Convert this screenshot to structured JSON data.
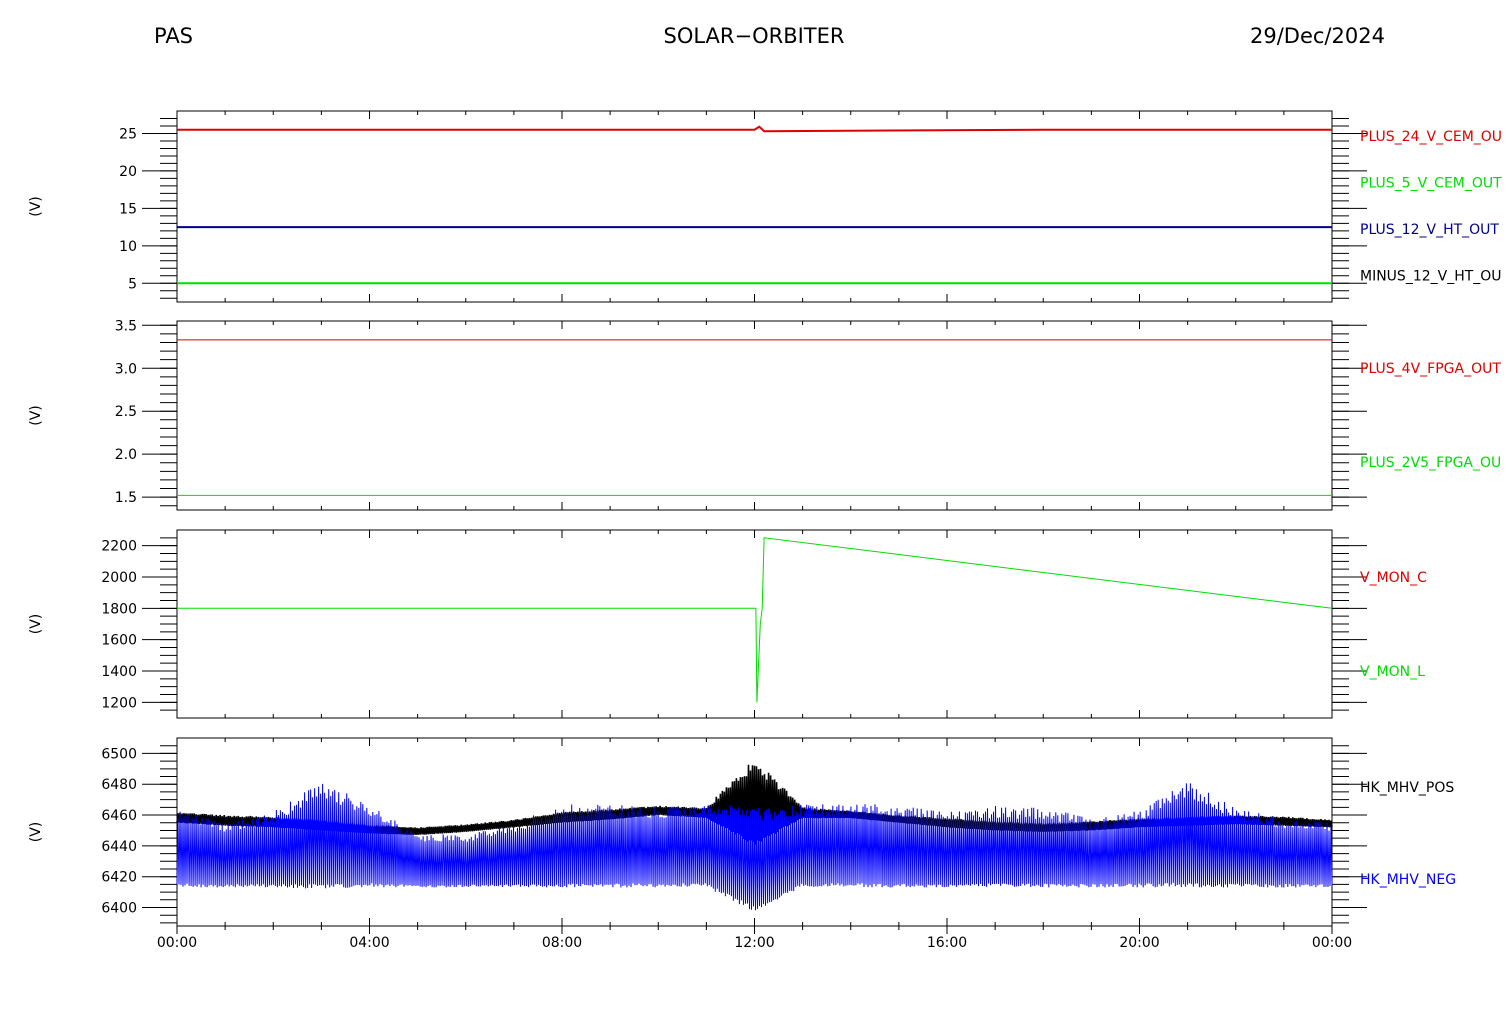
{
  "header": {
    "left": "PAS",
    "center": "SOLAR−ORBITER",
    "right": "29/Dec/2024"
  },
  "colors": {
    "red": "#dd0000",
    "green": "#00dd00",
    "navy": "#000088",
    "blue": "#0000ff",
    "black": "#000000"
  },
  "x_ticks": [
    "00:00",
    "04:00",
    "08:00",
    "12:00",
    "16:00",
    "20:00",
    "00:00"
  ],
  "chart_data": [
    {
      "type": "line",
      "ylabel": "(V)",
      "xlim": [
        0,
        24
      ],
      "ylim": [
        2.5,
        28
      ],
      "yticks": [
        5,
        10,
        15,
        20,
        25
      ],
      "minor": 1,
      "legend": [
        "PLUS_24_V_CEM_OU",
        "PLUS_5_V_CEM_OUT",
        "PLUS_12_V_HT_OUT",
        "MINUS_12_V_HT_OU"
      ],
      "legend_colors": [
        "red",
        "green",
        "navy",
        "black"
      ],
      "series": [
        {
          "name": "PLUS_24_V_CEM_OU",
          "color": "red",
          "x": [
            0,
            6,
            12,
            12.1,
            12.2,
            18,
            24
          ],
          "y": [
            25.5,
            25.5,
            25.5,
            25.9,
            25.3,
            25.5,
            25.5
          ]
        },
        {
          "name": "PLUS_5_V_CEM_OUT",
          "color": "green",
          "x": [
            0,
            24
          ],
          "y": [
            5.0,
            5.0
          ]
        },
        {
          "name": "PLUS_12_V_HT_OUT",
          "color": "navy",
          "x": [
            0,
            24
          ],
          "y": [
            12.5,
            12.5
          ]
        }
      ]
    },
    {
      "type": "line",
      "ylabel": "(V)",
      "xlim": [
        0,
        24
      ],
      "ylim": [
        1.35,
        3.55
      ],
      "yticks": [
        1.5,
        2.0,
        2.5,
        3.0,
        3.5
      ],
      "minor": 0.1,
      "legend": [
        "PLUS_4V_FPGA_OUT",
        "PLUS_2V5_FPGA_OU"
      ],
      "legend_colors": [
        "red",
        "green"
      ],
      "series": [
        {
          "name": "PLUS_4V_FPGA_OUT",
          "color": "red",
          "x": [
            0,
            24
          ],
          "y": [
            3.33,
            3.33
          ]
        },
        {
          "name": "PLUS_2V5_FPGA_OU",
          "color": "green",
          "x": [
            0,
            24
          ],
          "y": [
            1.52,
            1.52
          ]
        }
      ]
    },
    {
      "type": "line",
      "ylabel": "(V)",
      "xlim": [
        0,
        24
      ],
      "ylim": [
        1100,
        2300
      ],
      "yticks": [
        1200,
        1400,
        1600,
        1800,
        2000,
        2200
      ],
      "minor": 50,
      "legend": [
        "V_MON_C",
        "V_MON_L"
      ],
      "legend_colors": [
        "red",
        "green"
      ],
      "series": [
        {
          "name": "V_MON_L",
          "color": "green",
          "x": [
            0,
            12.03,
            12.05,
            12.12,
            12.16,
            12.2,
            24
          ],
          "y": [
            1800,
            1800,
            1200,
            1700,
            1800,
            2250,
            1800
          ]
        }
      ]
    },
    {
      "type": "line",
      "ylabel": "(V)",
      "xlim": [
        0,
        24
      ],
      "ylim": [
        6388,
        6510
      ],
      "yticks": [
        6400,
        6420,
        6440,
        6460,
        6480,
        6500
      ],
      "minor": 5,
      "legend": [
        "HK_MHV_POS",
        "HK_MHV_NEG"
      ],
      "legend_colors": [
        "black",
        "blue"
      ],
      "series": [
        {
          "name": "HK_MHV_POS",
          "color": "black",
          "band": true,
          "x": [
            0,
            1,
            2,
            3,
            4,
            5,
            6,
            7,
            8,
            9,
            10,
            11,
            12,
            13,
            14,
            15,
            16,
            17,
            18,
            19,
            20,
            21,
            22,
            23,
            24
          ],
          "y_low": [
            6455,
            6453,
            6452,
            6450,
            6448,
            6447,
            6449,
            6452,
            6455,
            6457,
            6460,
            6458,
            6440,
            6458,
            6458,
            6455,
            6452,
            6450,
            6449,
            6450,
            6452,
            6453,
            6454,
            6453,
            6452
          ],
          "y_high": [
            6462,
            6460,
            6459,
            6457,
            6454,
            6452,
            6454,
            6457,
            6462,
            6464,
            6466,
            6465,
            6498,
            6465,
            6463,
            6460,
            6458,
            6456,
            6455,
            6456,
            6458,
            6459,
            6460,
            6459,
            6457
          ]
        },
        {
          "name": "HK_MHV_NEG",
          "color": "blue",
          "band": true,
          "x": [
            0,
            1,
            2,
            3,
            4,
            5,
            6,
            7,
            8,
            9,
            10,
            11,
            12,
            13,
            14,
            15,
            16,
            17,
            18,
            19,
            20,
            21,
            22,
            23,
            24
          ],
          "y_low": [
            6413,
            6413,
            6413,
            6412,
            6413,
            6413,
            6413,
            6413,
            6413,
            6413,
            6413,
            6413,
            6397,
            6413,
            6413,
            6413,
            6413,
            6413,
            6413,
            6413,
            6413,
            6413,
            6413,
            6413,
            6413
          ],
          "y_high": [
            6463,
            6455,
            6462,
            6482,
            6467,
            6448,
            6447,
            6455,
            6467,
            6467,
            6466,
            6467,
            6467,
            6467,
            6467,
            6467,
            6462,
            6466,
            6465,
            6458,
            6463,
            6482,
            6465,
            6458,
            6455
          ]
        }
      ]
    }
  ]
}
